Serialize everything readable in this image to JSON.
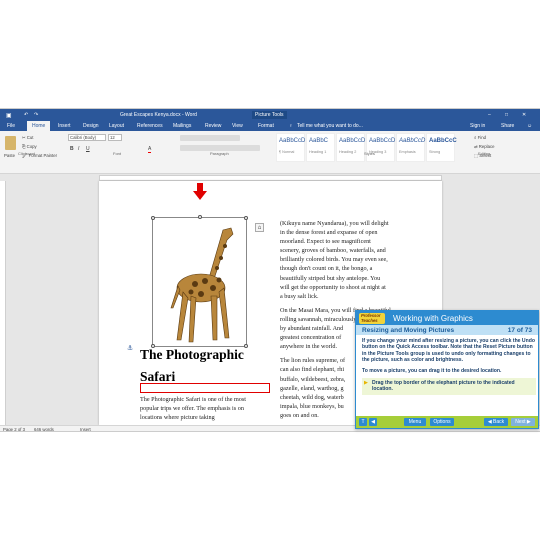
{
  "window": {
    "doc_title": "Great Escapes Kenya.docx - Word",
    "context_tab": "Picture Tools",
    "sign_in": "Sign in",
    "share": "Share"
  },
  "tabs": [
    "File",
    "Home",
    "Insert",
    "Design",
    "Layout",
    "References",
    "Mailings",
    "Review",
    "View",
    "Format"
  ],
  "tell_me": "Tell me what you want to do...",
  "ribbon": {
    "paste": "Paste",
    "cut": "Cut",
    "copy": "Copy",
    "format_painter": "Format Painter",
    "font_name": "Calibri (Body)",
    "font_size": "12",
    "styles": [
      {
        "sample": "AaBbCcD",
        "name": "¶ Normal"
      },
      {
        "sample": "AaBbC",
        "name": "Heading 1"
      },
      {
        "sample": "AaBbCcD",
        "name": "Heading 2"
      },
      {
        "sample": "AaBbCcD",
        "name": "Heading 3"
      },
      {
        "sample": "AaBbCcD",
        "name": "Emphasis"
      },
      {
        "sample": "AaBbCcC",
        "name": "Strong"
      }
    ],
    "find": "Find",
    "replace": "Replace",
    "select": "Select",
    "groups": {
      "clipboard": "Clipboard",
      "font": "Font",
      "paragraph": "Paragraph",
      "styles": "Styles",
      "editing": "Editing"
    }
  },
  "doc": {
    "heading_line1": "The Photographic",
    "heading_line2": "Safari",
    "left_para": [
      "The Photographic Safari is one of the most",
      "popular trips we offer. The emphasis is on",
      "locations where picture taking"
    ],
    "right_col": [
      "(Kikuyu name Nyandarua), you will delight",
      "in the dense forest and expanse of open",
      "moorland. Expect to see magnificent",
      "scenery, groves of bamboo, waterfalls, and",
      "brilliantly colored birds. You may even see,",
      "though don't count on it, the bongo, a",
      "beautifully striped but shy antelope. You",
      "will get the opportunity to shoot at night at",
      "a busy salt lick.",
      "",
      "On the Masai Mara, you will find a beautiful",
      "rolling savannah, miraculously",
      "by abundant rainfall. And",
      "greatest concentration of",
      "anywhere in the world.",
      "",
      "The lion rules supreme, of",
      "can also find elephant, rhi",
      "buffalo, wildebeest, zebra,",
      "gazelle, eland, warthog, g",
      "cheetah, wild dog, waterb",
      "impala, blue monkeys, bu",
      "goes on and on."
    ]
  },
  "status": {
    "page": "Page 2 of 3",
    "words": "646 words",
    "mode": "Insert"
  },
  "tutor": {
    "logo": "Professor Teaches",
    "title": "Working with Graphics",
    "subtitle": "Resizing and Moving Pictures",
    "progress": "17 of 73",
    "para1": "If you change your mind after resizing a picture, you can click the Undo button on the Quick Access toolbar. Note that the Reset Picture button in the Picture Tools group is used to undo only formatting changes to the picture, such as color and brightness.",
    "para2": "To move a picture, you can drag it to the desired location.",
    "instruction": "Drag the top border of the elephant picture to the indicated location.",
    "menu": "Menu",
    "options": "Options",
    "back": "Back",
    "next": "Next",
    "progress_fraction": 0.23
  }
}
